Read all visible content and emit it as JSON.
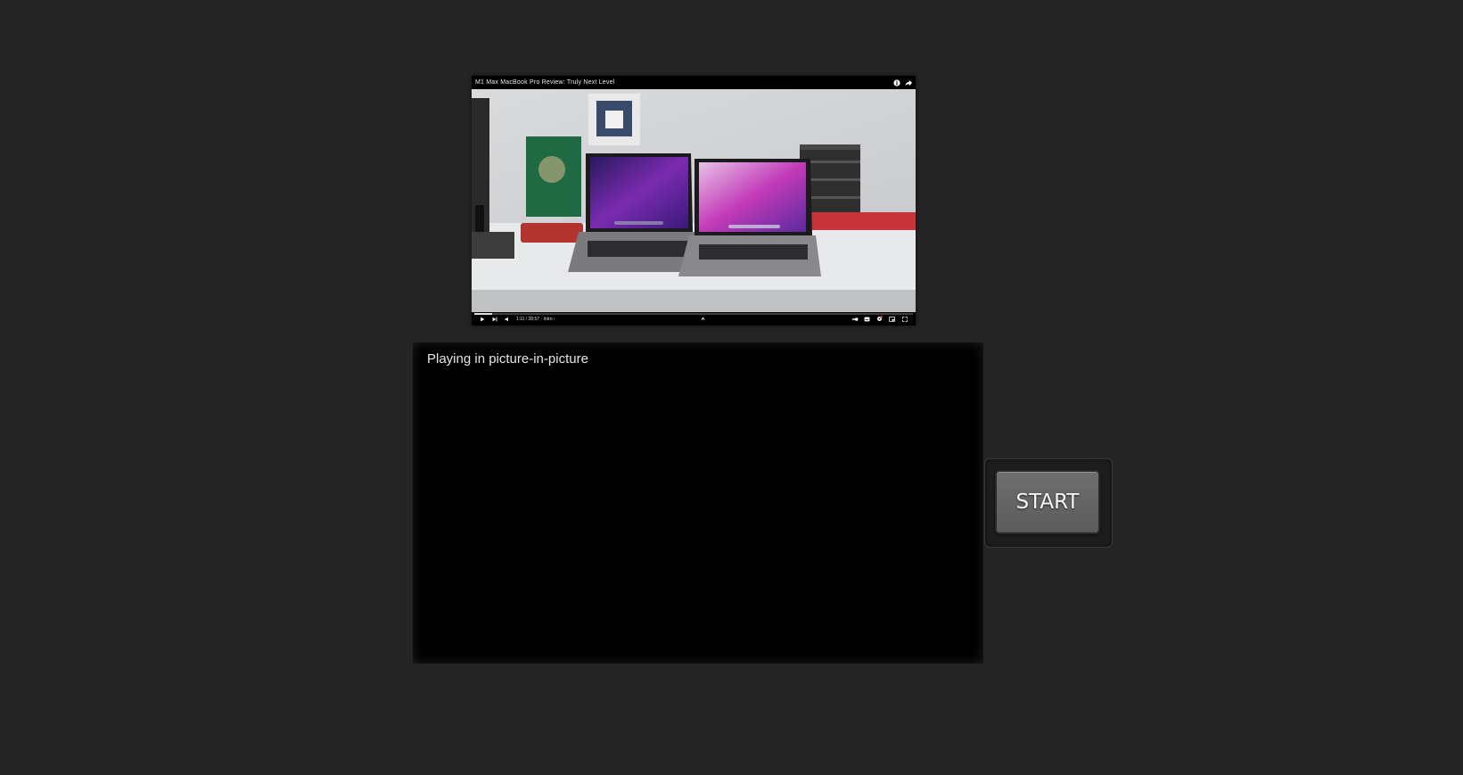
{
  "pip_window": {
    "title": "M1 Max MacBook Pro Review: Truly Next Level",
    "time": "1:11 / 28:57 · Intro ›",
    "progress": 0.04,
    "icons": {
      "info": "info-icon",
      "share": "share-icon",
      "play": "play-icon",
      "next": "next-icon",
      "volume": "volume-icon",
      "chapter": "chevron-up-icon",
      "autoplay": "autoplay-toggle-icon",
      "subtitles": "subtitles-icon",
      "settings": "settings-icon",
      "miniplayer": "miniplayer-icon",
      "fullscreen": "fullscreen-icon"
    }
  },
  "player": {
    "message": "Playing in picture-in-picture"
  },
  "start_button": {
    "label": "START"
  }
}
